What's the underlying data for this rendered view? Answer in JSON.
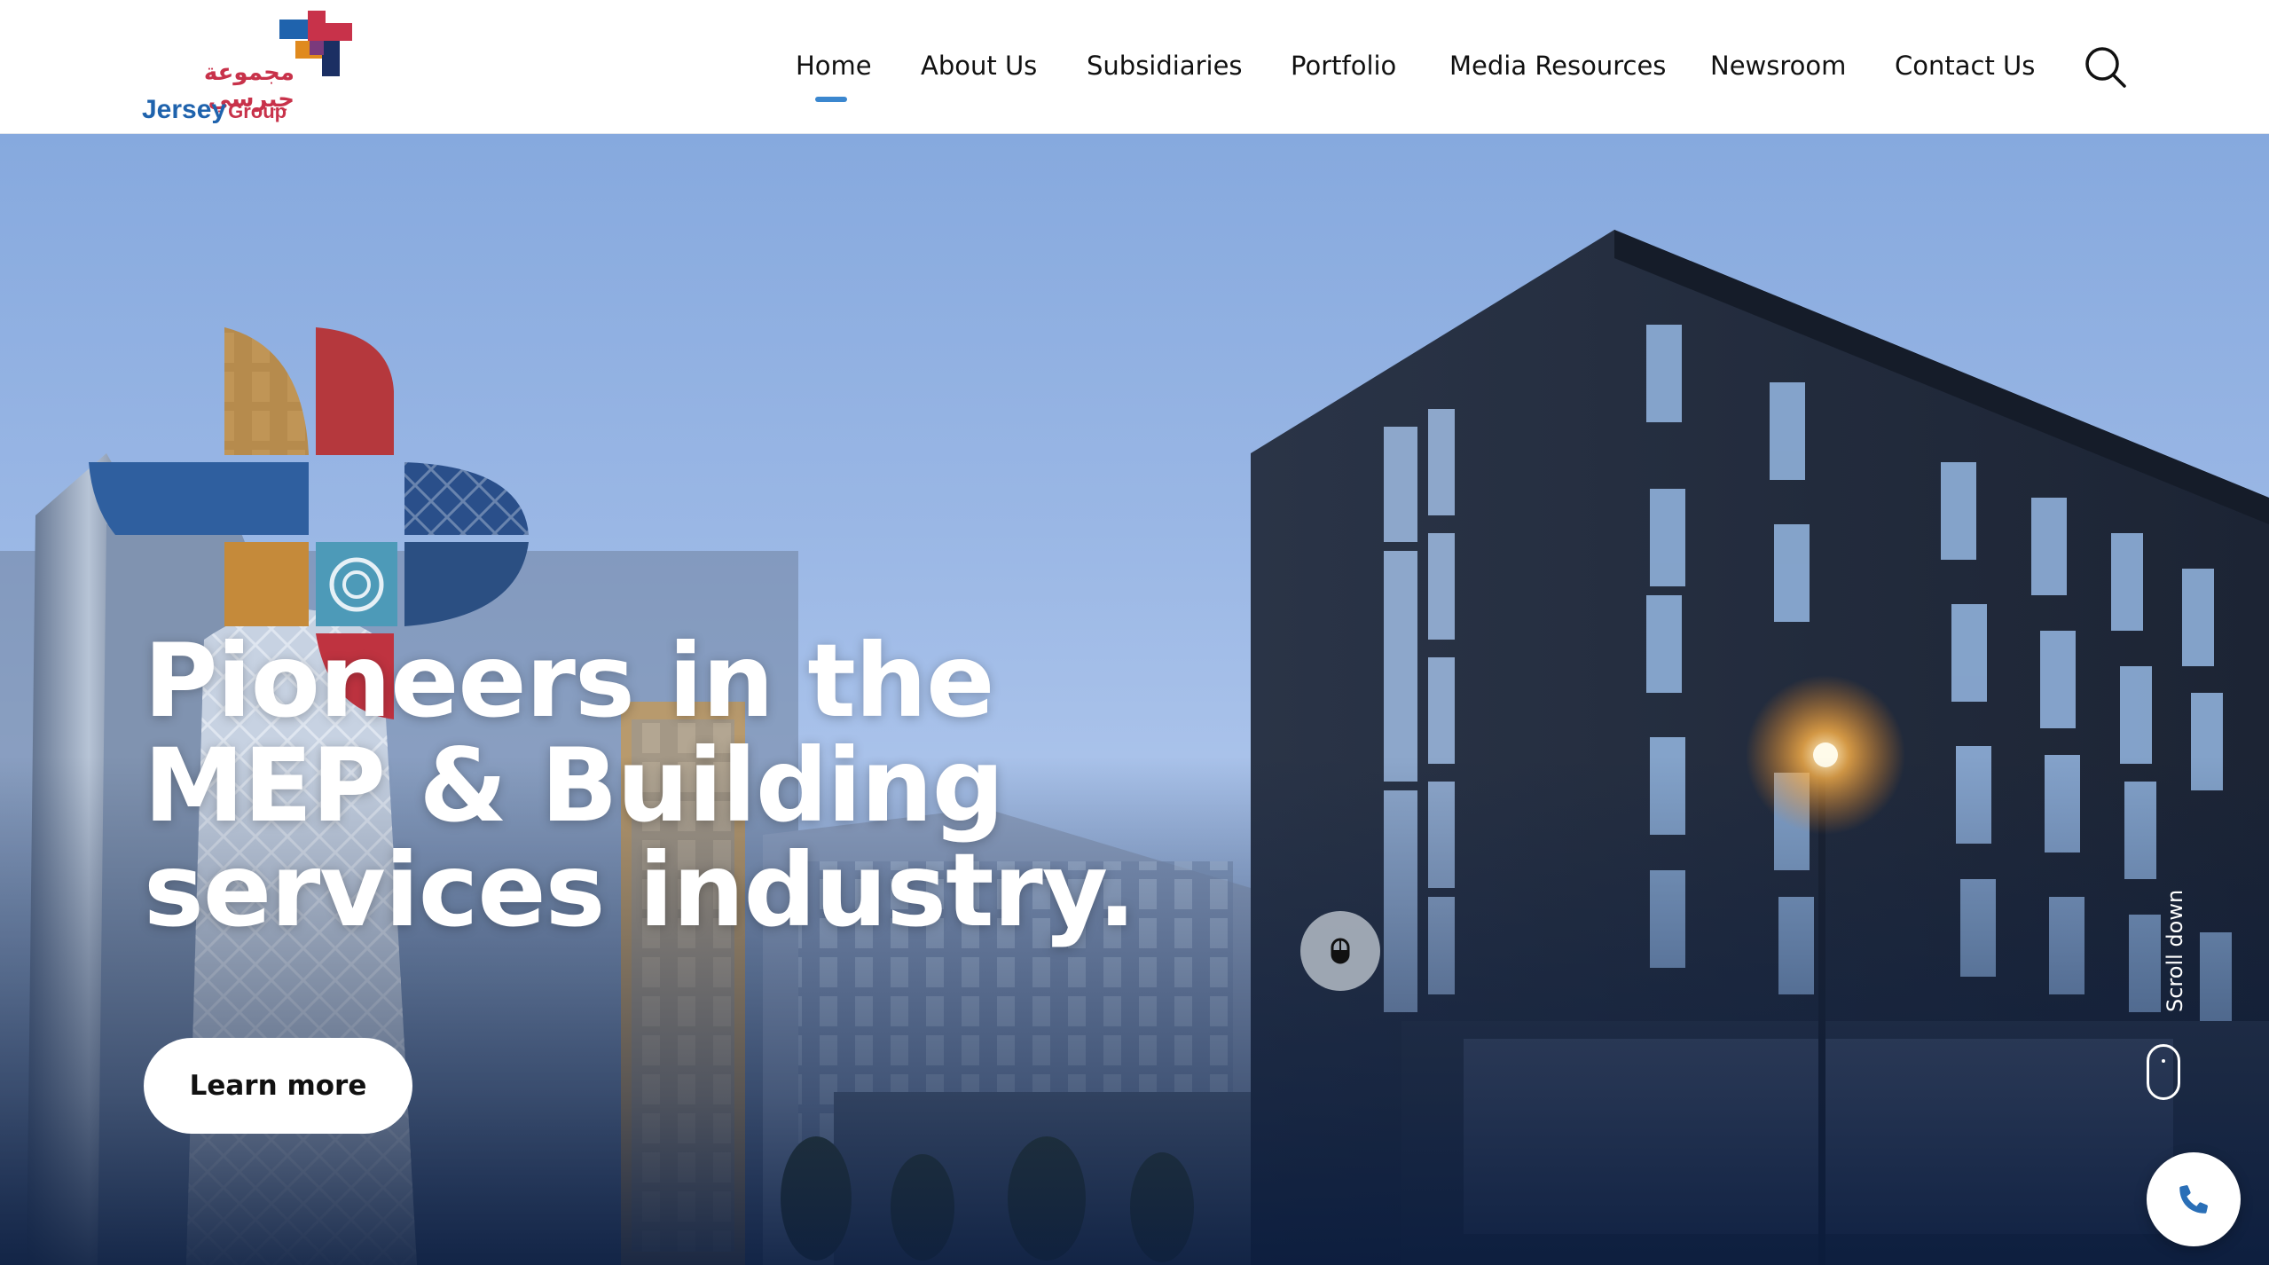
{
  "brand": {
    "name_ar": "مجموعة جيرسي",
    "name_en_main": "Jersey",
    "name_en_sub": "Group",
    "colors": {
      "blue": "#1f63ad",
      "red": "#c8324a",
      "orange": "#e08a1e",
      "navy": "#1b2f63"
    }
  },
  "nav": {
    "items": [
      "Home",
      "About Us",
      "Subsidiaries",
      "Portfolio",
      "Media Resources",
      "Newsroom",
      "Contact Us"
    ],
    "active": "Home",
    "active_color": "#3b87cf",
    "search_icon": "search-icon"
  },
  "hero": {
    "headline_lines": [
      "Pioneers in the",
      "MEP & Building",
      "services industry."
    ],
    "cta_label": "Learn more",
    "scroll_label": "Scroll down",
    "call_icon": "phone-icon"
  }
}
